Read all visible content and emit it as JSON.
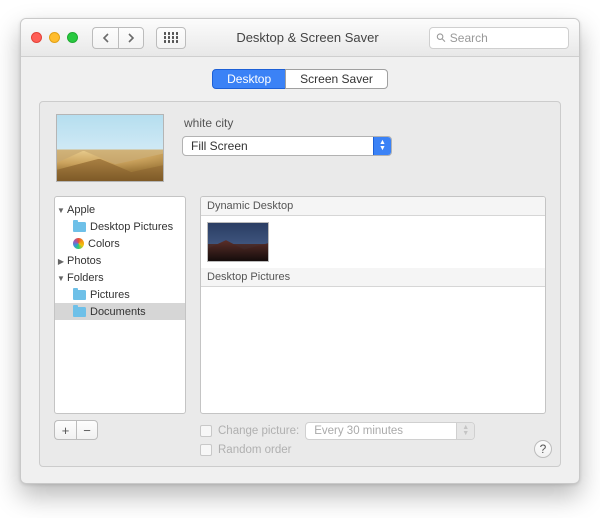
{
  "window": {
    "title": "Desktop & Screen Saver"
  },
  "search": {
    "placeholder": "Search"
  },
  "tabs": {
    "desktop": "Desktop",
    "screensaver": "Screen Saver"
  },
  "wallpaper": {
    "name": "white city",
    "fit_mode": "Fill Screen"
  },
  "sidebar": {
    "apple": "Apple",
    "desktop_pictures": "Desktop Pictures",
    "colors": "Colors",
    "photos": "Photos",
    "folders": "Folders",
    "pictures": "Pictures",
    "documents": "Documents"
  },
  "sections": {
    "dynamic": "Dynamic Desktop",
    "desktop_pictures": "Desktop Pictures"
  },
  "footer": {
    "change_picture": "Change picture:",
    "interval": "Every 30 minutes",
    "random_order": "Random order"
  },
  "buttons": {
    "add": "+",
    "remove": "−",
    "help": "?"
  }
}
